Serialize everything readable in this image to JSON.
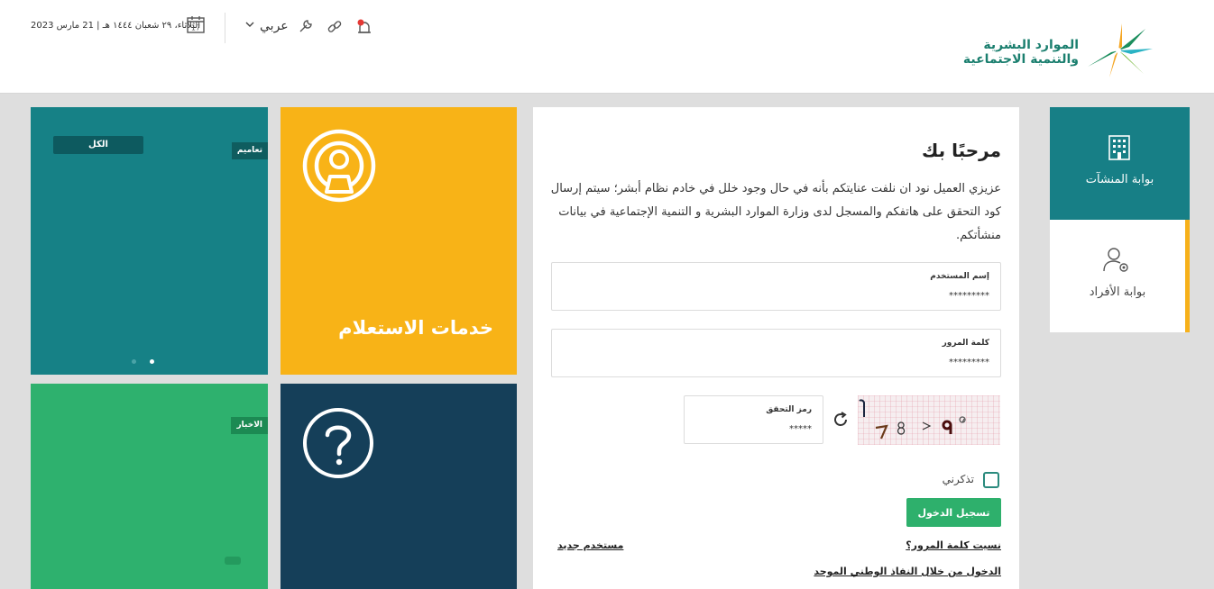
{
  "header": {
    "logo_line1": "الموارد البشرية",
    "logo_line2": "والتنمية الاجتماعية",
    "date": "الثلاثاء، ٢٩ شعبان ١٤٤٤ هـ | 21 مارس 2023",
    "calendar_day": "17",
    "language": "عربي",
    "icons": [
      "calendar-icon",
      "chevron-down-icon",
      "wrench-icon",
      "link-icon",
      "bell-icon"
    ]
  },
  "portals": {
    "establishments": "بوابة المنشآت",
    "individuals": "بوابة الأفراد"
  },
  "login": {
    "title": "مرحبًا بك",
    "description": "عزيزي العميل نود ان نلفت عنايتكم بأنه في حال وجود خلل في خادم نظام أبشر؛ سيتم إرسال كود التحقق على هاتفكم والمسجل لدى وزارة الموارد البشرية و التنمية الإجتماعية في بيانات منشأتكم.",
    "username_label": "إسم المستخدم",
    "username_value": "*********",
    "password_label": "كلمة المرور",
    "password_value": "*********",
    "code_label": "رمز التحقق",
    "code_value": "*****",
    "remember_label": "تذكرني",
    "login_button": "تسجيل الدخول",
    "forgot_link": "نسيت كلمة المرور؟",
    "new_user_link": "مستخدم جديد",
    "nafath_link": "الدخول من خلال النفاذ الوطني الموحد"
  },
  "tiles": {
    "inquiry": "خدمات الاستعلام",
    "all": "الكل",
    "circulars": "تعاميم",
    "news": "الاخبار"
  },
  "colors": {
    "teal": "#168186",
    "yellow": "#f8b317",
    "navy": "#153f59",
    "green": "#2eb16e"
  }
}
